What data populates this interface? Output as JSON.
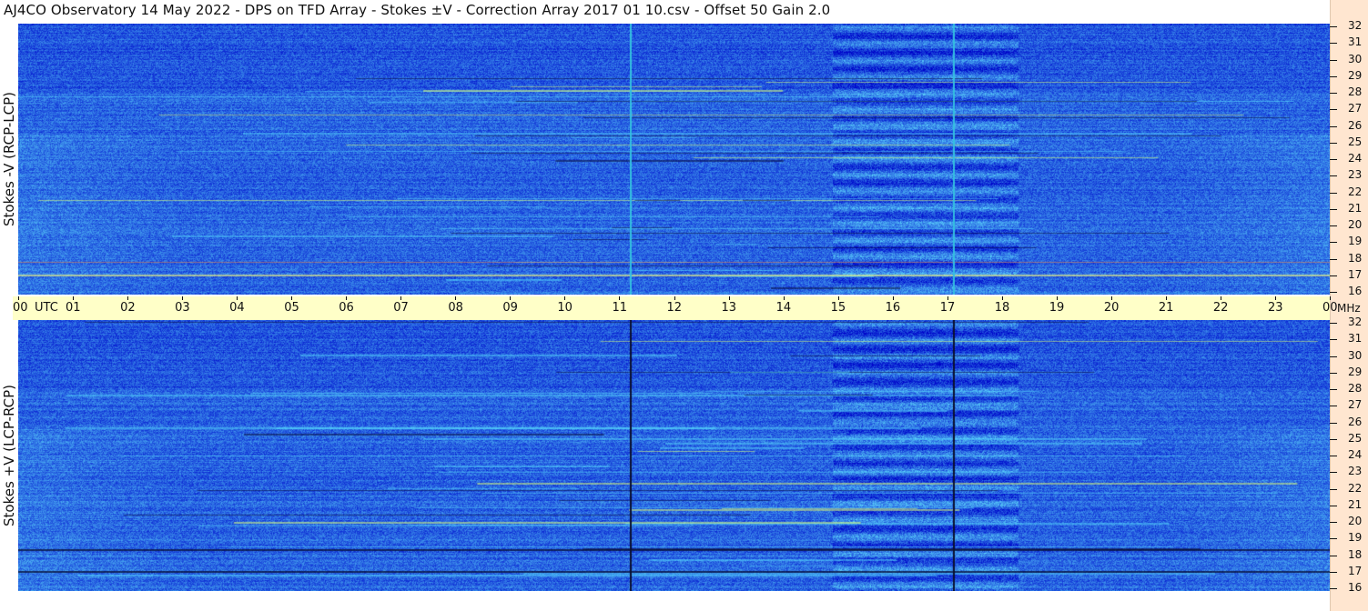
{
  "title": "AJ4CO Observatory  14 May 2022  -  DPS on TFD Array  -  Stokes ±V  -  Correction Array 2017 01 10.csv  -  Offset 50  Gain 2.0",
  "colors": {
    "background": "#2b63e6",
    "time_band": "#ffffc8",
    "freq_strip": "#ffe6d0"
  },
  "chart_data": [
    {
      "type": "heatmap",
      "panel": "top",
      "ylabel": "Stokes -V (RCP-LCP)",
      "x_start": "00",
      "x_end": "00",
      "x_unit": "UTC",
      "y_unit": "MHz",
      "ylim": [
        16,
        32
      ],
      "y_ticks": [
        "32",
        "31",
        "30",
        "29",
        "28",
        "27",
        "26",
        "25",
        "24",
        "23",
        "22",
        "21",
        "20",
        "19",
        "18",
        "17",
        "16"
      ],
      "vertical_lines_utc": [
        11.2,
        17.1
      ],
      "vertical_line_color": "#33c0e0"
    },
    {
      "type": "heatmap",
      "panel": "bottom",
      "ylabel": "Stokes +V (LCP-RCP)",
      "x_start": "00",
      "x_end": "00",
      "x_unit": "UTC",
      "y_unit": "MHz",
      "ylim": [
        16,
        32
      ],
      "y_ticks": [
        "32",
        "31",
        "30",
        "29",
        "28",
        "27",
        "26",
        "25",
        "24",
        "23",
        "22",
        "21",
        "20",
        "19",
        "18",
        "17",
        "16"
      ],
      "vertical_lines_utc": [
        11.2,
        17.1
      ],
      "vertical_line_color": "#0a1030"
    }
  ],
  "time_axis": {
    "labels": [
      "00",
      "01",
      "02",
      "03",
      "04",
      "05",
      "06",
      "07",
      "08",
      "09",
      "10",
      "11",
      "12",
      "13",
      "14",
      "15",
      "16",
      "17",
      "18",
      "19",
      "20",
      "21",
      "22",
      "23",
      "00"
    ],
    "utc_label": "UTC",
    "mhz_label": "MHz"
  }
}
